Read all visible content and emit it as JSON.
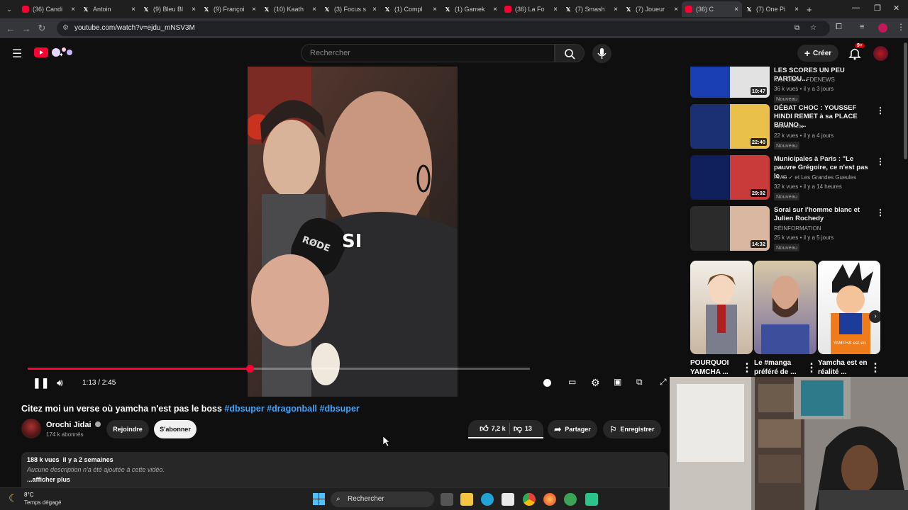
{
  "browser": {
    "tabs": [
      {
        "icon": "youtube-icon",
        "title": "(36) Candi"
      },
      {
        "icon": "x-icon",
        "title": "Antoin"
      },
      {
        "icon": "x-icon",
        "title": "(9) Bleu Bl"
      },
      {
        "icon": "x-icon",
        "title": "(9) Françoi"
      },
      {
        "icon": "x-icon",
        "title": "(10) Kaath"
      },
      {
        "icon": "x-icon",
        "title": "(3) Focus s"
      },
      {
        "icon": "x-icon",
        "title": "(1) Compl"
      },
      {
        "icon": "x-icon",
        "title": "(1) Gamek"
      },
      {
        "icon": "youtube-icon",
        "title": "(36) La Fo"
      },
      {
        "icon": "x-icon",
        "title": "(7) Smash"
      },
      {
        "icon": "x-icon",
        "title": "(7) Joueur"
      },
      {
        "icon": "youtube-icon",
        "title": "(36) C"
      },
      {
        "icon": "x-icon",
        "title": "(7) One Pi"
      }
    ],
    "url": "youtube.com/watch?v=ejdu_mNSV3M"
  },
  "header": {
    "search_placeholder": "Rechercher",
    "create_label": "Créer",
    "notif_count": "9+"
  },
  "player": {
    "caption": "SI",
    "time": "1:13 / 2:45",
    "progress_fraction": 0.4424
  },
  "video": {
    "title_plain": "Citez moi un verse où yamcha n'est pas le boss",
    "hashtags": [
      "#dbsuper",
      "#dragonball",
      "#dbsuper"
    ],
    "channel_name": "Orochi Jidai",
    "subscribers": "174 k abonnés",
    "join_label": "Rejoindre",
    "subscribe_label": "S'abonner",
    "likes": "7,2 k",
    "dislikes": "13",
    "share_label": "Partager",
    "save_label": "Enregistrer",
    "views_date": "188 k vues  il y a 2 semaines",
    "description": "Aucune description n'a été ajoutée à cette vidéo.",
    "show_more": "...afficher plus"
  },
  "sidebar": {
    "videos": [
      {
        "title": "LES SCORES UN PEU PARTOU...",
        "channel": "Kroc Blanc - FDENEWS",
        "meta": "36 k vues • il y a 3 jours",
        "badge": "Nouveau",
        "duration": "10:47"
      },
      {
        "title": "DÉBAT CHOC : YOUSSEF HINDI REMET à sa PLACE BRUNO ...",
        "channel": "Kentra Actu",
        "meta": "22 k vues • il y a 4 jours",
        "badge": "Nouveau",
        "duration": "22:40"
      },
      {
        "title": "Municipales à Paris : \"Le pauvre Grégoire, ce n'est pas le ...",
        "channel": "RMC ✓ et Les Grandes Gueules",
        "meta": "32 k vues • il y a 14 heures",
        "badge": "Nouveau",
        "duration": "29:02"
      },
      {
        "title": "Soral sur l'homme blanc et Julien Rochedy",
        "channel": "RÉINFORMATION",
        "meta": "25 k vues • il y a 5 jours",
        "badge": "Nouveau",
        "duration": "14:32"
      }
    ],
    "shorts": [
      {
        "title": "POURQUOI YAMCHA ..."
      },
      {
        "title": "Le #manga préféré de ..."
      },
      {
        "title": "Yamcha est en réalité ..."
      }
    ]
  },
  "taskbar": {
    "weather_temp": "8°C",
    "weather_desc": "Temps dégagé",
    "search_label": "Rechercher"
  },
  "colors": {
    "accent_red": "#ff0033",
    "link_blue": "#3ea6ff",
    "background": "#0f0f0f"
  }
}
